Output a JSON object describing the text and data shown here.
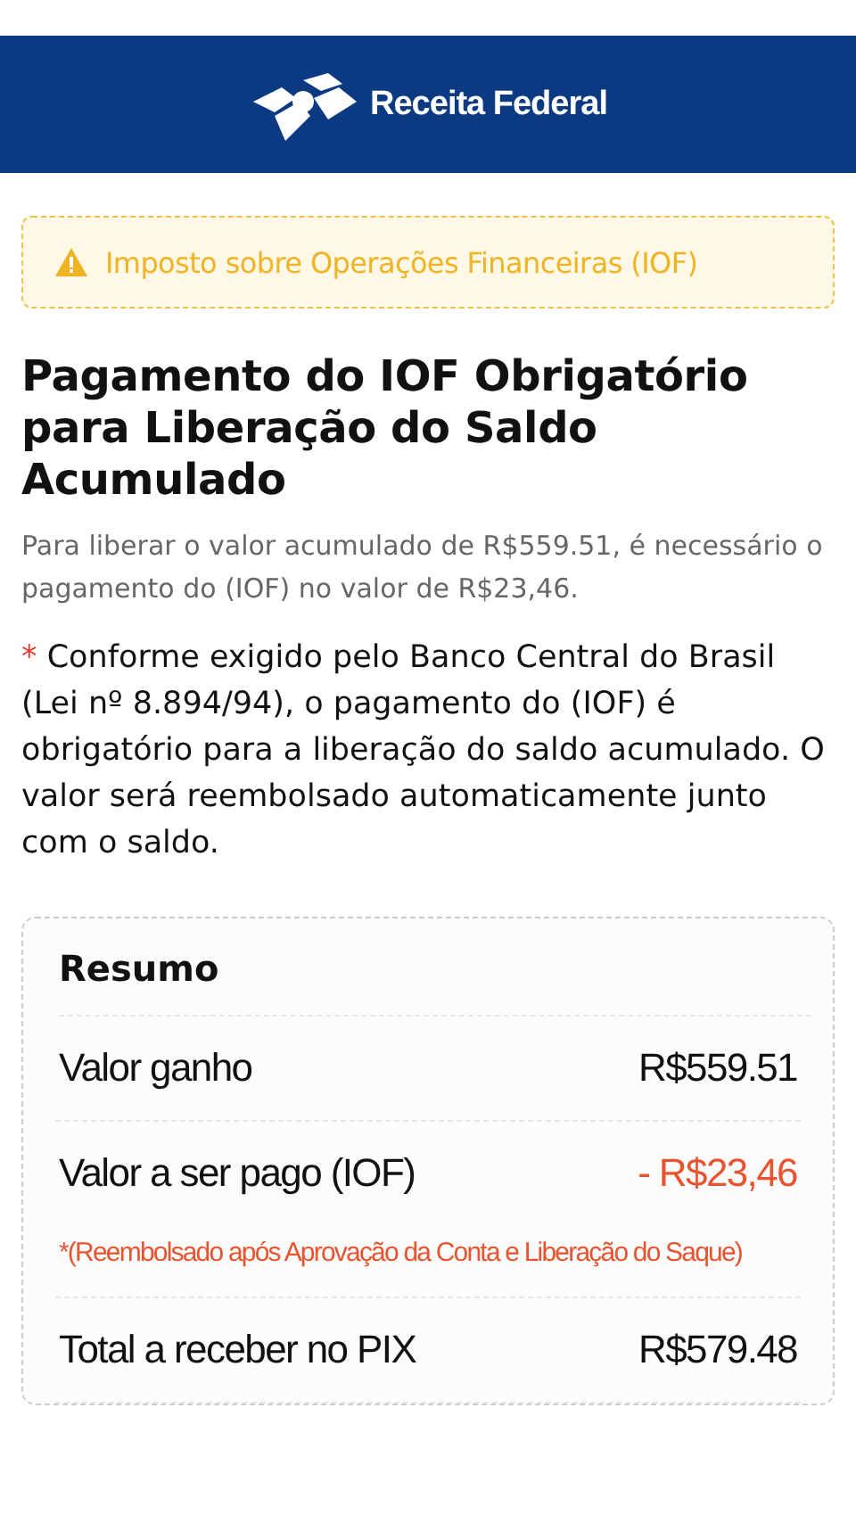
{
  "header": {
    "brand": "Receita Federal"
  },
  "alert": {
    "text": "Imposto sobre Operações Financeiras (IOF)"
  },
  "title": "Pagamento do IOF Obrigatório para Liberação do Saldo Acumulado",
  "description": "Para liberar o valor acumulado de R$559.51, é necessário o pagamento do (IOF) no valor de R$23,46.",
  "notice": {
    "mark": "*",
    "text": "Conforme exigido pelo Banco Central do Brasil (Lei nº 8.894/94), o pagamento do (IOF) é obrigatório para a liberação do saldo acumulado. O valor será reembolsado automaticamente junto com o saldo."
  },
  "summary": {
    "title": "Resumo",
    "rows": [
      {
        "kind": "amount",
        "label": "Valor ganho",
        "value": "R$559.51",
        "negative": false
      },
      {
        "kind": "amount",
        "label": "Valor a ser pago (IOF)",
        "value": "- R$23,46",
        "negative": true
      },
      {
        "kind": "note",
        "text": "*(Reembolsado após Aprovação da Conta e Liberação do Saque)"
      },
      {
        "kind": "amount",
        "label": "Total a receber no PIX",
        "value": "R$579.48",
        "negative": false
      }
    ]
  }
}
